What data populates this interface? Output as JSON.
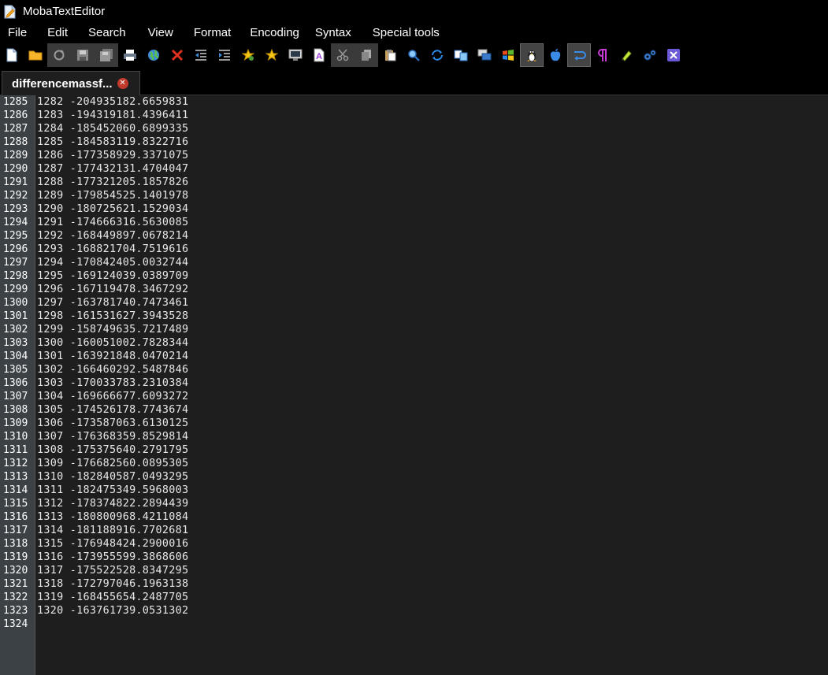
{
  "window": {
    "title": "MobaTextEditor"
  },
  "menu": [
    "File",
    "Edit",
    "Search",
    "View",
    "Format",
    "Encoding",
    "Syntax",
    "Special tools"
  ],
  "toolbar": {
    "icons": [
      "new-file-icon",
      "open-folder-icon",
      "reload-icon",
      "save-icon",
      "save-all-icon",
      "print-icon",
      "web-preview-icon",
      "close-file-icon",
      "unindent-icon",
      "indent-icon",
      "bookmark-add-icon",
      "bookmark-icon",
      "screen-icon",
      "font-icon",
      "cut-icon",
      "copy-icon",
      "paste-icon",
      "find-icon",
      "replace-icon",
      "compare-icon",
      "windows-icon",
      "windows-logo-icon",
      "linux-icon",
      "apple-icon",
      "word-wrap-icon",
      "pilcrow-icon",
      "highlight-icon",
      "settings-icon",
      "close-x-icon"
    ]
  },
  "tab": {
    "label": "differencemassf..."
  },
  "editor": {
    "line_numbers": [
      "1285",
      "1286",
      "1287",
      "1288",
      "1289",
      "1290",
      "1291",
      "1292",
      "1293",
      "1294",
      "1295",
      "1296",
      "1297",
      "1298",
      "1299",
      "1300",
      "1301",
      "1302",
      "1303",
      "1304",
      "1305",
      "1306",
      "1307",
      "1308",
      "1309",
      "1310",
      "1311",
      "1312",
      "1313",
      "1314",
      "1315",
      "1316",
      "1317",
      "1318",
      "1319",
      "1320",
      "1321",
      "1322",
      "1323",
      "1324"
    ],
    "lines": [
      "1282 -204935182.6659831",
      "1283 -194319181.4396411",
      "1284 -185452060.6899335",
      "1285 -184583119.8322716",
      "1286 -177358929.3371075",
      "1287 -177432131.4704047",
      "1288 -177321205.1857826",
      "1289 -179854525.1401978",
      "1290 -180725621.1529034",
      "1291 -174666316.5630085",
      "1292 -168449897.0678214",
      "1293 -168821704.7519616",
      "1294 -170842405.0032744",
      "1295 -169124039.0389709",
      "1296 -167119478.3467292",
      "1297 -163781740.7473461",
      "1298 -161531627.3943528",
      "1299 -158749635.7217489",
      "1300 -160051002.7828344",
      "1301 -163921848.0470214",
      "1302 -166460292.5487846",
      "1303 -170033783.2310384",
      "1304 -169666677.6093272",
      "1305 -174526178.7743674",
      "1306 -173587063.6130125",
      "1307 -176368359.8529814",
      "1308 -175375640.2791795",
      "1309 -176682560.0895305",
      "1310 -182840587.0493295",
      "1311 -182475349.5968003",
      "1312 -178374822.2894439",
      "1313 -180800968.4211084",
      "1314 -181188916.7702681",
      "1315 -176948424.2900016",
      "1316 -173955599.3868606",
      "1317 -175522528.8347295",
      "1318 -172797046.1963138",
      "1319 -168455654.2487705",
      "1320 -163761739.0531302",
      ""
    ]
  }
}
